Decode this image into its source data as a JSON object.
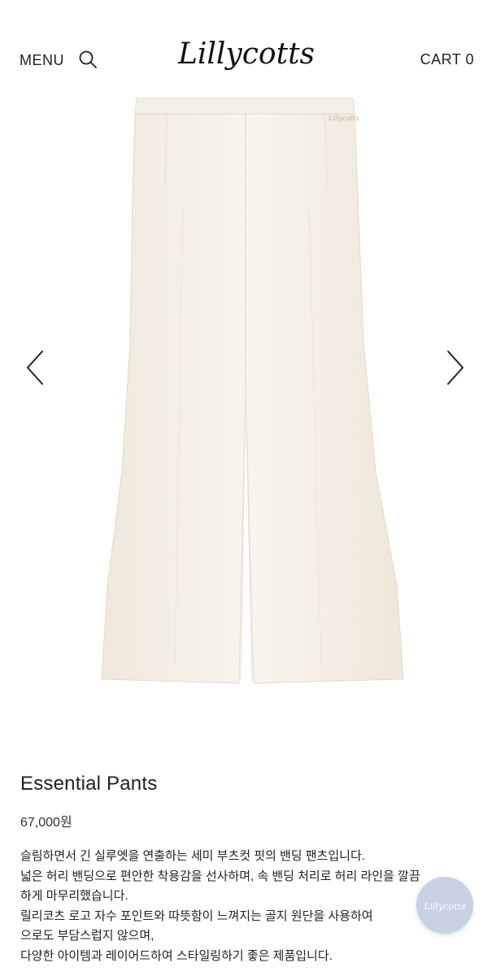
{
  "header": {
    "menu_label": "MENU",
    "logo_text": "Lillycotts",
    "cart_label": "CART 0"
  },
  "product": {
    "title": "Essential Pants",
    "price": "67,000원",
    "description_lines": [
      "슬림하면서 긴 실루엣을 연출하는 세미 부츠컷 핏의 밴딩 팬츠입니다.",
      "넓은 허리 밴딩으로 편안한 착용감을 선사하며, 속 밴딩 처리로 허리 라인을 깔끔",
      "하게 마무리했습니다.",
      "릴리코츠 로고 자수 포인트와 따뜻함이 느껴지는 골지 원단을 사용하여",
      "으로도 부담스럽지 않으며,",
      "다양한 아이템과 레이어드하여 스타일링하기 좋은 제품입니다."
    ]
  },
  "image": {
    "product_color": "#f5f1e8",
    "embroidery_text": "Lillycotts"
  },
  "chat_badge": {
    "logo_text": "Lillycotts",
    "color": "#c9d2e4"
  }
}
